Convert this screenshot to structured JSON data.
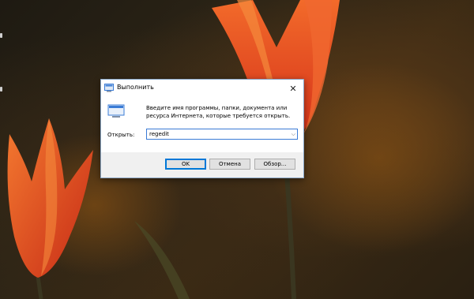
{
  "desktop": {
    "wallpaper": "red-tulips",
    "colors": {
      "petal": "#e2401c",
      "petal_light": "#f46a2c",
      "stem": "#3a3a1e"
    }
  },
  "run_dialog": {
    "title": "Выполнить",
    "description": "Введите имя программы, папки, документа или ресурса Интернета, которые требуется открыть.",
    "open_label": "Открыть:",
    "input_value": "regedit",
    "buttons": {
      "ok": "OK",
      "cancel": "Отмена",
      "browse": "Обзор..."
    },
    "icons": {
      "title": "run-icon",
      "body": "run-icon",
      "close": "close-icon",
      "dropdown": "chevron-down-icon"
    },
    "accent": "#0078d7"
  }
}
